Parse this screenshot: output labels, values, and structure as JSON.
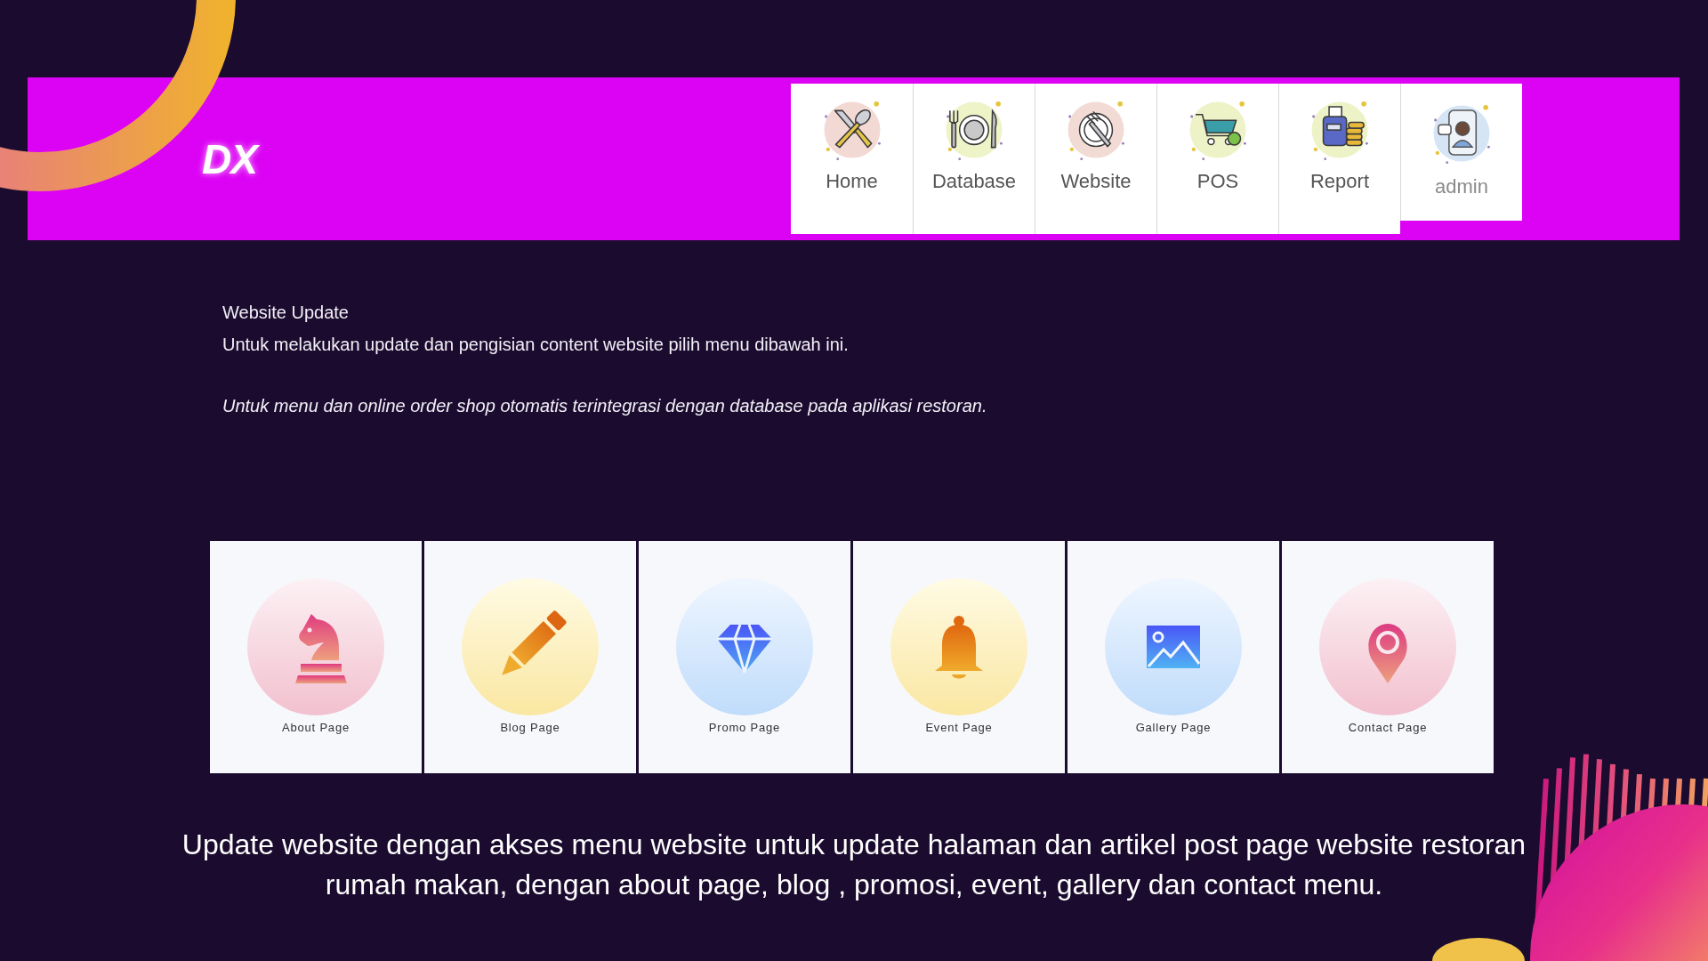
{
  "header": {
    "logo": "DX",
    "menu": [
      {
        "label": "Home",
        "kind": "menu"
      },
      {
        "label": "Database",
        "kind": "menu"
      },
      {
        "label": "Website",
        "kind": "menu"
      },
      {
        "label": "POS",
        "kind": "menu"
      },
      {
        "label": "Report",
        "kind": "menu"
      },
      {
        "label": "admin",
        "kind": "user"
      }
    ]
  },
  "intro": {
    "title": "Website Update",
    "text": "Untuk melakukan update dan pengisian content website pilih menu dibawah ini.",
    "note": "Untuk menu dan online order shop otomatis terintegrasi dengan database pada aplikasi restoran."
  },
  "page_cards": [
    {
      "label": "About Page"
    },
    {
      "label": "Blog Page"
    },
    {
      "label": "Promo Page"
    },
    {
      "label": "Event Page"
    },
    {
      "label": "Gallery Page"
    },
    {
      "label": "Contact Page"
    }
  ],
  "caption": {
    "lines": [
      "Update website dengan akses menu website untuk update halaman dan artikel post page website restoran",
      "rumah makan, dengan about page, blog , promosi, event, gallery dan contact menu."
    ]
  }
}
